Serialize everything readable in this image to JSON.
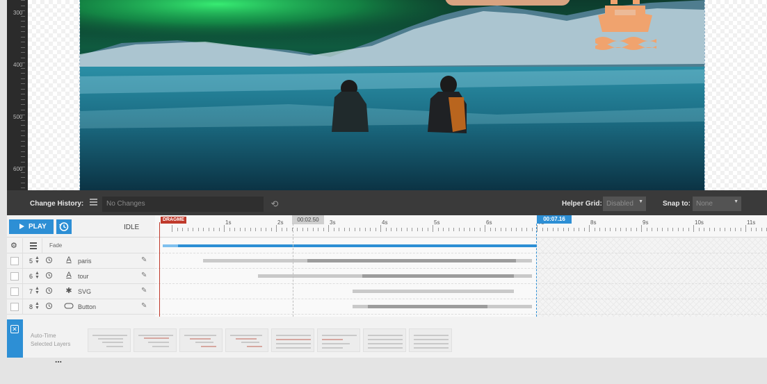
{
  "vruler": {
    "labels": [
      "300",
      "400",
      "500",
      "600"
    ]
  },
  "history": {
    "label": "Change History:",
    "menu_icon": "hamburger-icon",
    "value": "No Changes",
    "reset_icon": "undo-icon"
  },
  "helper_grid": {
    "label": "Helper Grid:",
    "value": "Disabled"
  },
  "snap": {
    "label": "Snap to:",
    "value": "None"
  },
  "controls": {
    "play_label": "PLAY",
    "history_icon": "history-icon",
    "state": "IDLE"
  },
  "ruler": {
    "drag_label": "DRAGME",
    "hover_time": "00:02.50",
    "end_time": "00:07.16",
    "seconds": [
      "1s",
      "2s",
      "3s",
      "4s",
      "5s",
      "6s",
      "7s",
      "8s",
      "9s",
      "10s",
      "11s"
    ]
  },
  "layer_header": {
    "settings_icon": "gear-icon",
    "list_icon": "hamburger-icon",
    "effect": "Fade"
  },
  "layers": [
    {
      "num": "5",
      "type_icon": "text-layer-icon",
      "name": "paris"
    },
    {
      "num": "6",
      "type_icon": "text-layer-icon",
      "name": "tour"
    },
    {
      "num": "7",
      "type_icon": "puzzle-icon",
      "name": "SVG"
    },
    {
      "num": "8",
      "type_icon": "button-layer-icon",
      "name": "Button"
    }
  ],
  "autotime": {
    "line1": "Auto-Time",
    "line2": "Selected Layers"
  },
  "footer": {
    "dots": "..."
  },
  "colors": {
    "accent": "#2d8fd5",
    "playhead": "#c0392b",
    "ship": "#f0a36e"
  }
}
